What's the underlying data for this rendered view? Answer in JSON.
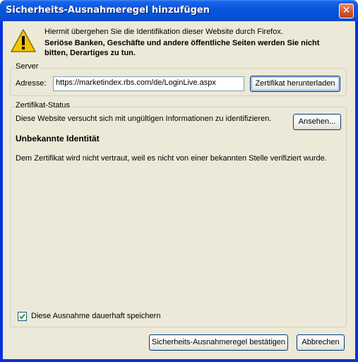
{
  "window": {
    "title": "Sicherheits-Ausnahmeregel hinzufügen",
    "close_glyph": "✕"
  },
  "intro": {
    "line1": "Hiermit übergehen Sie die Identifikation dieser Website durch Firefox.",
    "line2": "Seriöse Banken, Geschäfte und andere öffentliche Seiten werden Sie nicht",
    "line3": "bitten, Derartiges zu tun."
  },
  "server": {
    "legend": "Server",
    "address_label": "Adresse:",
    "address_value": "https://marketindex.rbs.com/de/LoginLive.aspx",
    "download_button": "Zertifikat herunterladen"
  },
  "cert_status": {
    "legend": "Zertifikat-Status",
    "message": "Diese Website versucht sich mit ungültigen Informationen zu identifizieren.",
    "view_button": "Ansehen...",
    "heading": "Unbekannte Identität",
    "detail": "Dem Zertifikat wird nicht vertraut, weil es nicht von einer bekannten Stelle verifiziert wurde."
  },
  "permanent": {
    "label": "Diese Ausnahme dauerhaft speichern",
    "checked": true
  },
  "actions": {
    "confirm": "Sicherheits-Ausnahmeregel bestätigen",
    "cancel": "Abbrechen"
  },
  "colors": {
    "titlebar": "#0a56de",
    "dialog_bg": "#ece9d8",
    "warning": "#f5c400"
  },
  "icons": {
    "warning": "warning-triangle-icon",
    "close": "close-icon",
    "check": "checkmark-icon"
  }
}
